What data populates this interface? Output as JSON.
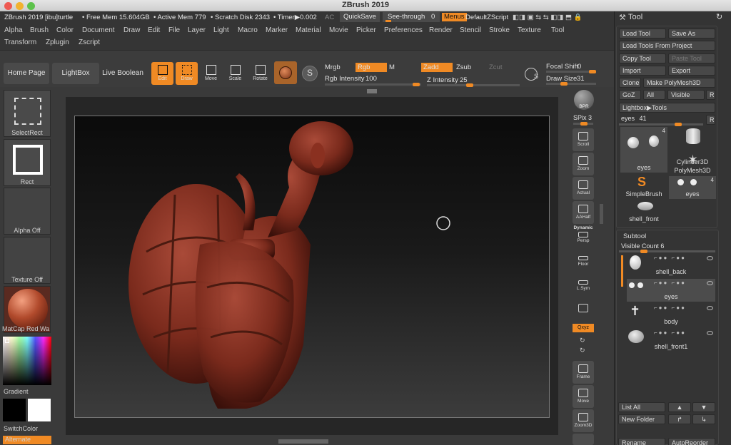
{
  "window": {
    "title": "ZBrush 2019"
  },
  "topbar": {
    "app_info": "ZBrush 2019 [ibu]turtle",
    "free_mem": "• Free Mem 15.604GB",
    "active_mem": "• Active Mem 779",
    "scratch_disk": "• Scratch Disk 2343",
    "timer": "• Timer▶0.002",
    "ac": "AC",
    "quicksave": "QuickSave",
    "see_through_label": "See-through",
    "see_through_value": "0",
    "see_through_level": 0,
    "menus_toggle": "Menus",
    "default_zscript": "DefaultZScript"
  },
  "menus": {
    "row1": [
      "Alpha",
      "Brush",
      "Color",
      "Document",
      "Draw",
      "Edit",
      "File",
      "Layer",
      "Light",
      "Macro",
      "Marker",
      "Material",
      "Movie",
      "Picker",
      "Preferences",
      "Render",
      "Stencil",
      "Stroke",
      "Texture",
      "Tool"
    ],
    "row2": [
      "Transform",
      "Zplugin",
      "Zscript"
    ]
  },
  "shelf": {
    "home_page": "Home Page",
    "lightbox": "LightBox",
    "live_boolean": "Live Boolean",
    "edit": "Edit",
    "draw": "Draw",
    "move": "Move",
    "scale": "Scale",
    "rotate": "Rotate",
    "mrgb": "Mrgb",
    "rgb": "Rgb",
    "m": "M",
    "zadd": "Zadd",
    "zsub": "Zsub",
    "zcut": "Zcut",
    "rgb_intensity_label": "Rgb Intensity",
    "rgb_intensity_value": "100",
    "z_intensity_label": "Z Intensity",
    "z_intensity_value": "25",
    "focal_shift_label": "Focal Shift",
    "focal_shift_value": "0",
    "draw_size_label": "Draw Size",
    "draw_size_value": "31",
    "s_label": "S"
  },
  "left_tray": {
    "select_rect": "SelectRect",
    "rect": "Rect",
    "alpha_off": "Alpha Off",
    "texture_off": "Texture Off",
    "matcap": "MatCap Red Wa",
    "gradient": "Gradient",
    "switch_color": "SwitchColor",
    "alternate": "Alternate"
  },
  "right_strip": {
    "bpr": "BPR",
    "spix_label": "SPix",
    "spix_value": "3",
    "scroll": "Scroll",
    "zoom": "Zoom",
    "actual": "Actual",
    "aahalf": "AAHalf",
    "dynamic": "Dynamic",
    "persp": "Persp",
    "floor": "Floor",
    "lsym": "L.Sym",
    "xyz": "Qxyz",
    "frame": "Frame",
    "move": "Move",
    "zoom3d": "Zoom3D"
  },
  "tool_panel": {
    "title": "Tool",
    "load_tool": "Load Tool",
    "save_as": "Save As",
    "load_tools_from_project": "Load Tools From Project",
    "copy_tool": "Copy Tool",
    "paste_tool": "Paste Tool",
    "import": "Import",
    "export": "Export",
    "clone": "Clone",
    "make_polymesh": "Make PolyMesh3D",
    "goz": "GoZ",
    "all": "All",
    "visible": "Visible",
    "r": "R",
    "lightbox_tools": "Lightbox▶Tools",
    "current_tool_label": "eyes",
    "current_tool_value": "41",
    "thumbs": [
      {
        "label": "eyes",
        "badge": "4"
      },
      {
        "label": "Cylinder3D",
        "badge": ""
      },
      {
        "label": "PolyMesh3D",
        "badge": ""
      },
      {
        "label": "SimpleBrush",
        "badge": ""
      },
      {
        "label": "eyes",
        "badge": "4"
      },
      {
        "label": "shell_front",
        "badge": ""
      }
    ],
    "subtool_title": "Subtool",
    "visible_count_label": "Visible Count",
    "visible_count_value": "6",
    "subtools": [
      "shell_back",
      "eyes",
      "body",
      "shell_front1"
    ],
    "list_all": "List All",
    "new_folder": "New Folder",
    "rename": "Rename",
    "auto_reorder": "AutoReorder"
  },
  "colors": {
    "accent": "#f08a24",
    "panel": "#343434",
    "button": "#484848"
  }
}
